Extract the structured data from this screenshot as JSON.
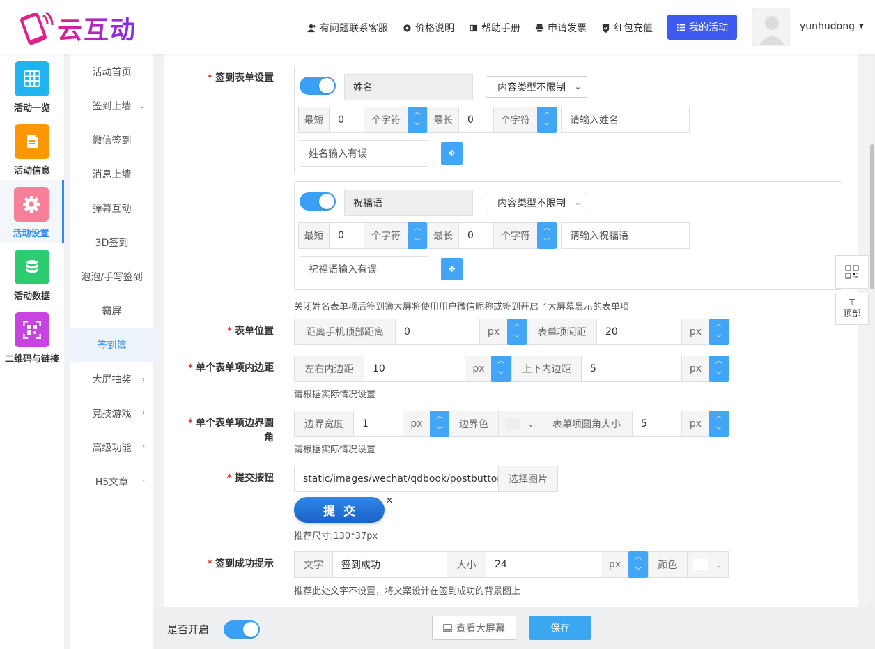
{
  "header": {
    "logo_text": "云互动",
    "nav": [
      {
        "label": "有问题联系客服",
        "icon": "user-add-icon"
      },
      {
        "label": "价格说明",
        "icon": "gear-icon"
      },
      {
        "label": "帮助手册",
        "icon": "book-icon"
      },
      {
        "label": "申请发票",
        "icon": "printer-icon"
      },
      {
        "label": "红包充值",
        "icon": "shield-check-icon"
      }
    ],
    "my_activity": "我的活动",
    "username": "yunhudong"
  },
  "sidebar": {
    "items": [
      {
        "label": "活动一览",
        "icon": "grid-icon",
        "color": "#1fb4f0"
      },
      {
        "label": "活动信息",
        "icon": "document-icon",
        "color": "#ff9800"
      },
      {
        "label": "活动设置",
        "icon": "gear-icon",
        "color": "#f77f9a"
      },
      {
        "label": "活动数据",
        "icon": "database-icon",
        "color": "#2ecc71"
      },
      {
        "label": "二维码与链接",
        "icon": "qrcode-icon",
        "color": "#c744e0"
      }
    ]
  },
  "subnav": {
    "items": [
      "活动首页",
      "签到上墙",
      "微信签到",
      "消息上墙",
      "弹幕互动",
      "3D签到",
      "泡泡/手写签到",
      "霸屏",
      "签到簿",
      "大屏抽奖",
      "竞技游戏",
      "高级功能",
      "H5文章"
    ]
  },
  "form": {
    "signin_form": {
      "label": "签到表单设置",
      "field1": {
        "name": "姓名",
        "type": "内容类型不限制",
        "min_label": "最短",
        "min": "0",
        "unit": "个字符",
        "max_label": "最长",
        "max": "0",
        "placeholder": "请输入姓名",
        "error": "姓名输入有误"
      },
      "field2": {
        "name": "祝福语",
        "type": "内容类型不限制",
        "min_label": "最短",
        "min": "0",
        "unit": "个字符",
        "max_label": "最长",
        "max": "0",
        "placeholder": "请输入祝福语",
        "error": "祝福语输入有误"
      },
      "hint": "关闭姓名表单项后签到簿大屏将使用用户微信昵称或签到开启了大屏幕显示的表单项"
    },
    "position": {
      "label": "表单位置",
      "top_label": "距离手机顶部距离",
      "top": "0",
      "unit": "px",
      "gap_label": "表单项间距",
      "gap": "20"
    },
    "padding": {
      "label": "单个表单项内边距",
      "lr_label": "左右内边距",
      "lr": "10",
      "unit": "px",
      "tb_label": "上下内边距",
      "tb": "5",
      "hint": "请根据实际情况设置"
    },
    "border": {
      "label_line1": "单个表单项边界圆",
      "label_line2": "角",
      "width_label": "边界宽度",
      "width": "1",
      "unit": "px",
      "color_label": "边界色",
      "radius_label": "表单项圆角大小",
      "radius": "5",
      "hint": "请根据实际情况设置"
    },
    "submit": {
      "label": "提交按钮",
      "path": "static/images/wechat/qdbook/postbutton.p",
      "choose": "选择图片",
      "button_text": "提交",
      "close": "×",
      "size_hint": "推荐尺寸:130*37px"
    },
    "success": {
      "label": "签到成功提示",
      "text_label": "文字",
      "text": "签到成功",
      "size_label": "大小",
      "size": "24",
      "unit": "px",
      "color_label": "颜色",
      "hint": "推荐此处文字不设置，将文案设计在签到成功的背景图上"
    }
  },
  "footer": {
    "enable_label": "是否开启",
    "preview": "查看大屏幕",
    "save": "保存"
  },
  "float": {
    "top_label": "顶部"
  },
  "colors": {
    "accent": "#42a5f5",
    "primary": "#3d5af1",
    "active_nav": "#2d8cf0"
  }
}
